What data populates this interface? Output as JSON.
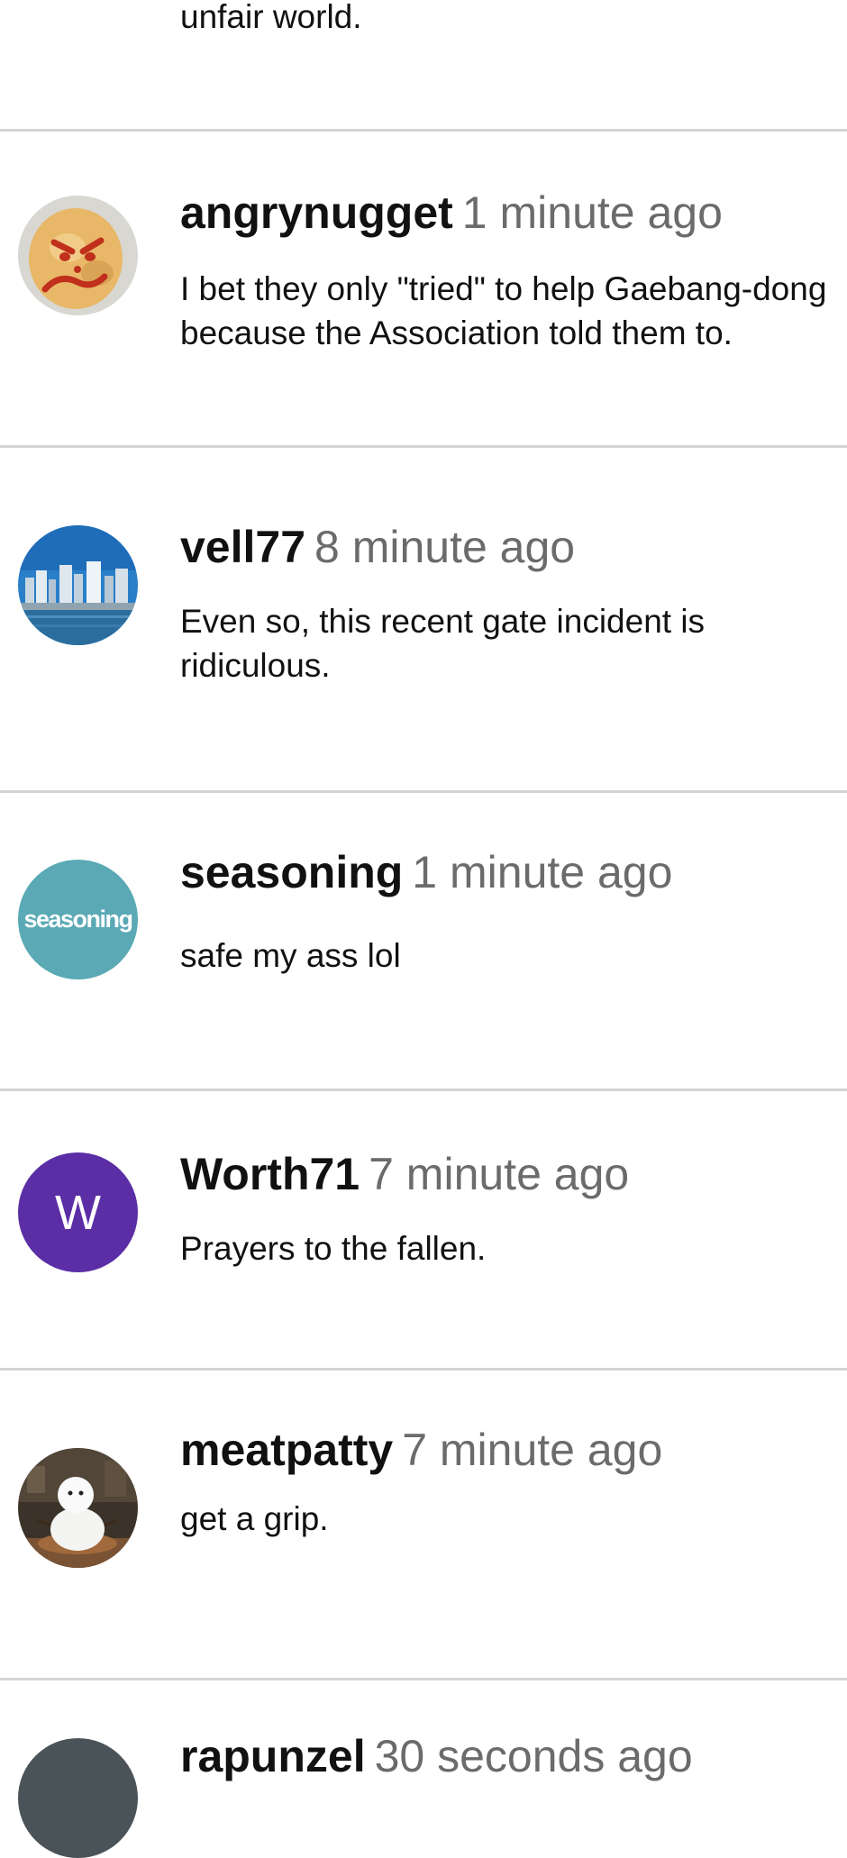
{
  "previous_comment": {
    "text": "unfair world."
  },
  "comments": [
    {
      "username": "angrynugget",
      "time": "1 minute ago",
      "text": "I bet they only \"tried\" to help Gaebang-dong because the Association told them to.",
      "avatar": {
        "type": "photo",
        "icon": "angry-nugget-avatar-icon"
      }
    },
    {
      "username": "vell77",
      "time": "8 minute ago",
      "text": "Even so, this recent gate incident is ridiculous.",
      "avatar": {
        "type": "photo",
        "icon": "city-skyline-avatar-icon"
      }
    },
    {
      "username": "seasoning",
      "time": "1 minute ago",
      "text": "safe my ass lol",
      "avatar": {
        "type": "text",
        "label": "seasoning",
        "color": "#5aa9b5"
      }
    },
    {
      "username": "Worth71",
      "time": "7 minute ago",
      "text": "Prayers to the fallen.",
      "avatar": {
        "type": "letter",
        "label": "W",
        "color": "#5b2ea6"
      }
    },
    {
      "username": "meatpatty",
      "time": "7 minute ago",
      "text": "get a grip.",
      "avatar": {
        "type": "photo",
        "icon": "snowman-avatar-icon"
      }
    },
    {
      "username": "rapunzel",
      "time": "30 seconds ago",
      "text": "",
      "avatar": {
        "type": "color",
        "color": "#4a5358"
      }
    }
  ],
  "colors": {
    "divider": "#d4d4d4",
    "timestamp": "#6b6b6b",
    "text": "#111111"
  }
}
